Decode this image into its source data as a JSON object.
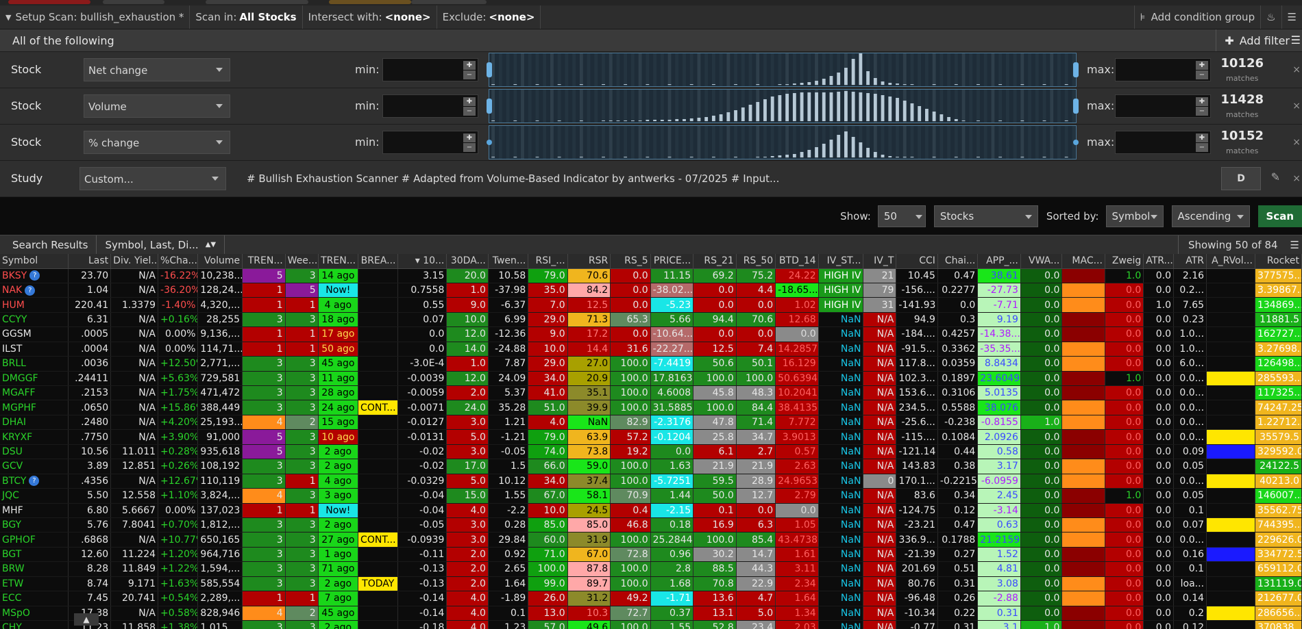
{
  "setup": {
    "title": "Setup Scan: bullish_exhaustion *",
    "scan_in_label": "Scan in:",
    "scan_in_value": "All Stocks",
    "intersect_label": "Intersect with:",
    "intersect_value": "<none>",
    "exclude_label": "Exclude:",
    "exclude_value": "<none>",
    "add_group": "Add condition group"
  },
  "all_following": "All of the following",
  "add_filter": "Add filter",
  "filters": [
    {
      "type": "Stock",
      "field": "Net change",
      "min_label": "min:",
      "max_label": "max:",
      "matches": "10126",
      "matches_label": "matches",
      "hist": [
        0,
        0,
        0,
        0,
        0,
        0,
        0,
        0,
        0,
        0,
        0,
        0,
        0,
        0,
        0,
        0,
        0,
        0,
        0,
        0,
        0,
        0,
        0,
        0,
        0,
        0,
        0,
        0,
        0,
        0,
        0,
        0,
        0,
        0,
        0,
        0,
        0,
        0,
        0,
        1,
        1,
        2,
        3,
        4,
        6,
        9,
        13,
        18,
        25,
        38,
        48,
        20,
        10,
        5,
        3,
        2,
        1,
        1,
        0,
        0,
        0,
        0,
        0,
        0,
        0,
        0,
        0,
        0,
        0,
        0,
        0,
        0,
        0,
        0,
        0,
        0,
        0,
        0,
        0,
        0
      ],
      "first": 4,
      "last": 0
    },
    {
      "type": "Stock",
      "field": "Volume",
      "min_label": "min:",
      "max_label": "max:",
      "matches": "11428",
      "matches_label": "matches",
      "hist": [
        0,
        0,
        0,
        0,
        0,
        0,
        0,
        0,
        0,
        0,
        0,
        0,
        0,
        0,
        0,
        1,
        1,
        1,
        1,
        1,
        1,
        2,
        2,
        2,
        2,
        3,
        3,
        4,
        5,
        6,
        8,
        10,
        13,
        16,
        20,
        24,
        28,
        32,
        36,
        38,
        40,
        41,
        42,
        42,
        42,
        42,
        42,
        43,
        44,
        43,
        42,
        41,
        40,
        38,
        36,
        34,
        30,
        26,
        22,
        18,
        14,
        10,
        6,
        3,
        1,
        0,
        0,
        0,
        0,
        0,
        0,
        0,
        0,
        0,
        0,
        0,
        0,
        0,
        0,
        0
      ],
      "first": 4,
      "last": 30
    },
    {
      "type": "Stock",
      "field": "% change",
      "min_label": "min:",
      "max_label": "max:",
      "matches": "10152",
      "matches_label": "matches",
      "hist": [
        0,
        0,
        0,
        0,
        0,
        0,
        0,
        0,
        0,
        0,
        0,
        0,
        0,
        0,
        0,
        0,
        0,
        0,
        0,
        0,
        0,
        0,
        0,
        0,
        0,
        0,
        0,
        0,
        0,
        0,
        0,
        0,
        0,
        0,
        0,
        0,
        1,
        1,
        2,
        3,
        4,
        5,
        8,
        11,
        15,
        20,
        26,
        33,
        38,
        30,
        22,
        14,
        8,
        4,
        2,
        1,
        1,
        0,
        0,
        0,
        0,
        0,
        0,
        0,
        0,
        0,
        0,
        0,
        0,
        0,
        0,
        0,
        0,
        0,
        0,
        0,
        0,
        0,
        0,
        0
      ],
      "first": 4,
      "last": 0
    }
  ],
  "study": {
    "label": "Study",
    "field": "Custom...",
    "script": "# Bullish Exhaustion Scanner # Adapted from Volume-Based Indicator by antwerks - 07/2025  # Input...",
    "agg": "D"
  },
  "show": {
    "label": "Show:",
    "count": "50",
    "type": "Stocks",
    "sorted_label": "Sorted by:",
    "sort_field": "Symbol",
    "order": "Ascending",
    "scan_button": "Scan"
  },
  "results": {
    "tab1": "Search Results",
    "tab2": "Symbol, Last, Di...",
    "showing": "Showing 50 of 84"
  },
  "columns": [
    "Symbol",
    "Last",
    "Div. Yiel...",
    "%Cha...",
    "Volume",
    "TREN...",
    "Wee...",
    "TREN...",
    "BREA...",
    "▾ 10...",
    "30DA...",
    "Twen...",
    "RSI_...",
    "RSR",
    "RS_5",
    "PRICE...",
    "RS_21",
    "RS_50",
    "BTD_14",
    "IV_ST...",
    "IV_T",
    "CCI",
    "Chai...",
    "APP_...",
    "VWA...",
    "MAC...",
    "Zweig",
    "ATR...",
    "ATR",
    "A_RVol...",
    "Rocket"
  ],
  "rows": [
    [
      "BKSY",
      "23.70",
      "N/A",
      "-16.22%",
      "10,238...",
      "5",
      "3",
      "14 ago",
      "",
      "3.15",
      "20.0",
      "10.58",
      "79.0",
      "70.6",
      "0.0",
      "11.15",
      "69.2",
      "75.2",
      "24.22",
      "HIGH IV",
      "21",
      "10.45",
      "0.47",
      "38.61",
      "0.0",
      "",
      "1.0",
      "0.0",
      "2.16",
      "",
      "377575..."
    ],
    [
      "NAK",
      "1.04",
      "N/A",
      "-36.20%",
      "128,24...",
      "1",
      "5",
      "Now!",
      "",
      "0.7558",
      "1.0",
      "-37.98",
      "35.0",
      "84.2",
      "0.0",
      "-38.02...",
      "0.0",
      "4.4",
      "-18.65...",
      "HIGH IV",
      "79",
      "-156....",
      "0.2277",
      "-27.73",
      "0.0",
      "",
      "0.0",
      "0.0",
      "0.2...",
      "",
      "3.39867..."
    ],
    [
      "HUM",
      "220.41",
      "1.3379",
      "-1.40%",
      "4,320,...",
      "1",
      "1",
      "4 ago",
      "",
      "0.55",
      "9.0",
      "-6.37",
      "7.0",
      "12.5",
      "0.0",
      "-5.23",
      "0.0",
      "0.0",
      "1.02",
      "HIGH IV",
      "31",
      "-141.93",
      "0.0",
      "-7.71",
      "0.0",
      "",
      "0.0",
      "1.0",
      "7.65",
      "",
      "134869..."
    ],
    [
      "CCYY",
      "6.31",
      "N/A",
      "+0.16%",
      "28,255",
      "3",
      "3",
      "18 ago",
      "",
      "0.07",
      "10.0",
      "6.99",
      "29.0",
      "71.3",
      "65.3",
      "5.66",
      "94.4",
      "70.6",
      "12.68",
      "NaN",
      "N/A",
      "94.9",
      "0.3",
      "9.19",
      "0.0",
      "",
      "0.0",
      "0.0",
      "0.23",
      "",
      "11881.5"
    ],
    [
      "GGSM",
      ".0005",
      "N/A",
      "0.00%",
      "9,136,...",
      "1",
      "1",
      "17 ago",
      "",
      "0.0",
      "12.0",
      "-12.36",
      "9.0",
      "17.2",
      "0.0",
      "-10.64...",
      "0.0",
      "0.0",
      "0.0",
      "NaN",
      "N/A",
      "-184....",
      "0.4257",
      "-14.38...",
      "0.0",
      "",
      "0.0",
      "0.0",
      "1.0...",
      "",
      "162727..."
    ],
    [
      "ILST",
      ".0004",
      "N/A",
      "0.00%",
      "114,71...",
      "1",
      "1",
      "50 ago",
      "",
      "0.0",
      "14.0",
      "-24.88",
      "10.0",
      "14.4",
      "31.6",
      "-22.27...",
      "12.5",
      "7.4",
      "14.2857",
      "NaN",
      "N/A",
      "-91.5...",
      "0.3362",
      "-35.35...",
      "0.0",
      "",
      "0.0",
      "0.0",
      "1.0...",
      "",
      "3.27698..."
    ],
    [
      "BRLL",
      ".0036",
      "N/A",
      "+12.50%",
      "2,771,...",
      "3",
      "3",
      "45 ago",
      "",
      "-3.0E-4",
      "1.0",
      "7.87",
      "29.0",
      "27.0",
      "100.0",
      "-7.4419",
      "50.6",
      "50.1",
      "16.129",
      "NaN",
      "N/A",
      "117.8...",
      "0.0359",
      "8.8434",
      "0.0",
      "",
      "0.0",
      "0.0",
      "6.0...",
      "",
      "126498..."
    ],
    [
      "DMGGF",
      ".24411",
      "N/A",
      "+5.63%",
      "729,581",
      "3",
      "3",
      "11 ago",
      "",
      "-0.0039",
      "12.0",
      "24.09",
      "34.0",
      "20.9",
      "100.0",
      "17.8163",
      "100.0",
      "100.0",
      "50.6394",
      "NaN",
      "N/A",
      "102.3...",
      "0.1897",
      "23.6049",
      "0.0",
      "",
      "1.0",
      "0.0",
      "0.0...",
      "",
      "285593..."
    ],
    [
      "MGAFF",
      ".2153",
      "N/A",
      "+1.75%",
      "471,472",
      "3",
      "3",
      "28 ago",
      "",
      "-0.0059",
      "2.0",
      "5.37",
      "41.0",
      "35.1",
      "100.0",
      "4.6008",
      "45.8",
      "48.3",
      "10.2041",
      "NaN",
      "N/A",
      "153.6...",
      "0.3106",
      "5.0135",
      "0.0",
      "",
      "0.0",
      "0.0",
      "0.0...",
      "",
      "117325..."
    ],
    [
      "MGPHF",
      ".0650",
      "N/A",
      "+15.86%",
      "388,449",
      "3",
      "3",
      "24 ago",
      "CONT...",
      "-0.0071",
      "24.0",
      "35.28",
      "51.0",
      "39.9",
      "100.0",
      "31.5885",
      "100.0",
      "84.4",
      "38.4135",
      "NaN",
      "N/A",
      "234.5...",
      "0.5588",
      "38.076",
      "0.0",
      "",
      "0.0",
      "0.0",
      "0.0...",
      "",
      "74247.25"
    ],
    [
      "DHAI",
      ".2480",
      "N/A",
      "+4.20%",
      "25,193...",
      "4",
      "2",
      "15 ago",
      "",
      "-0.0127",
      "3.0",
      "1.21",
      "4.0",
      "NaN",
      "82.9",
      "-2.3176",
      "47.8",
      "71.4",
      "7.772",
      "NaN",
      "N/A",
      "-25.6...",
      "-0.238",
      "-0.8155",
      "1.0",
      "",
      "0.0",
      "0.0",
      "0.0...",
      "",
      "1.22712..."
    ],
    [
      "KRYXF",
      ".7750",
      "N/A",
      "+3.90%",
      "91,000",
      "5",
      "3",
      "10 ago",
      "",
      "-0.0131",
      "5.0",
      "-1.21",
      "79.0",
      "63.9",
      "57.2",
      "-0.1204",
      "25.8",
      "34.7",
      "3.9013",
      "NaN",
      "N/A",
      "-115....",
      "0.1084",
      "2.0926",
      "0.0",
      "",
      "0.0",
      "0.0",
      "0.0...",
      "",
      "35579.5"
    ],
    [
      "DSU",
      "10.56",
      "11.011",
      "+0.28%",
      "935,618",
      "5",
      "3",
      "2 ago",
      "",
      "-0.02",
      "3.0",
      "-0.05",
      "74.0",
      "73.8",
      "19.2",
      "0.0",
      "6.1",
      "2.7",
      "0.57",
      "NaN",
      "N/A",
      "-121.14",
      "0.44",
      "0.58",
      "0.0",
      "",
      "0.0",
      "0.0",
      "0.09",
      "",
      "329592.0"
    ],
    [
      "GCV",
      "3.89",
      "12.851",
      "+0.26%",
      "108,192",
      "3",
      "3",
      "2 ago",
      "",
      "-0.02",
      "17.0",
      "1.5",
      "66.0",
      "59.0",
      "100.0",
      "1.63",
      "21.9",
      "21.9",
      "2.63",
      "NaN",
      "N/A",
      "143.83",
      "0.38",
      "3.17",
      "0.0",
      "",
      "0.0",
      "0.0",
      "0.05",
      "",
      "24122.5"
    ],
    [
      "BTCY",
      ".4356",
      "N/A",
      "+12.67%",
      "110,119",
      "3",
      "1",
      "4 ago",
      "",
      "-0.0329",
      "5.0",
      "10.12",
      "34.0",
      "37.4",
      "100.0",
      "-5.7251",
      "59.5",
      "28.9",
      "24.9653",
      "NaN",
      "0",
      "170.1...",
      "-0.2215",
      "-6.0959",
      "0.0",
      "",
      "0.0",
      "0.0",
      "0.0...",
      "",
      "40213.0"
    ],
    [
      "JQC",
      "5.50",
      "12.558",
      "+1.10%",
      "3,824,...",
      "4",
      "3",
      "3 ago",
      "",
      "-0.04",
      "15.0",
      "1.55",
      "67.0",
      "58.1",
      "70.9",
      "1.44",
      "50.0",
      "12.7",
      "2.79",
      "NaN",
      "N/A",
      "83.6",
      "0.34",
      "2.45",
      "0.0",
      "",
      "1.0",
      "0.0",
      "0.05",
      "",
      "146007..."
    ],
    [
      "MHF",
      "6.80",
      "5.6667",
      "0.00%",
      "137,023",
      "1",
      "1",
      "Now!",
      "",
      "-0.04",
      "4.0",
      "-2.2",
      "10.0",
      "24.5",
      "0.4",
      "-2.15",
      "0.1",
      "0.0",
      "0.0",
      "NaN",
      "N/A",
      "-124.75",
      "0.12",
      "-3.14",
      "0.0",
      "",
      "0.0",
      "0.0",
      "0.1",
      "",
      "35562.75"
    ],
    [
      "BGY",
      "5.76",
      "7.8041",
      "+0.70%",
      "1,812,...",
      "3",
      "3",
      "2 ago",
      "",
      "-0.05",
      "3.0",
      "0.28",
      "85.0",
      "85.0",
      "46.8",
      "0.18",
      "16.9",
      "6.3",
      "1.05",
      "NaN",
      "N/A",
      "-23.21",
      "0.47",
      "0.63",
      "0.0",
      "",
      "0.0",
      "0.0",
      "0.07",
      "",
      "744395..."
    ],
    [
      "GPHOF",
      ".6868",
      "N/A",
      "+10.77%",
      "650,165",
      "3",
      "3",
      "27 ago",
      "CONT...",
      "-0.0939",
      "3.0",
      "29.84",
      "60.0",
      "31.9",
      "100.0",
      "25.2844",
      "100.0",
      "85.4",
      "43.4738",
      "NaN",
      "N/A",
      "336.9...",
      "0.1788",
      "21.2159",
      "0.0",
      "",
      "0.0",
      "0.0",
      "0.0...",
      "",
      "229626.0"
    ],
    [
      "BGT",
      "12.60",
      "11.224",
      "+1.20%",
      "964,716",
      "3",
      "3",
      "1 ago",
      "",
      "-0.11",
      "2.0",
      "0.92",
      "71.0",
      "67.0",
      "72.8",
      "0.96",
      "30.2",
      "14.7",
      "1.61",
      "NaN",
      "N/A",
      "-21.39",
      "0.27",
      "1.52",
      "0.0",
      "",
      "0.0",
      "0.0",
      "0.16",
      "",
      "334772.5"
    ],
    [
      "BRW",
      "8.28",
      "11.849",
      "+1.22%",
      "1,594,...",
      "3",
      "3",
      "71 ago",
      "",
      "-0.13",
      "2.0",
      "2.65",
      "100.0",
      "87.8",
      "100.0",
      "2.8",
      "88.5",
      "44.3",
      "3.11",
      "NaN",
      "N/A",
      "201.69",
      "0.51",
      "4.81",
      "0.0",
      "",
      "0.0",
      "0.0",
      "0.1",
      "",
      "659112.0"
    ],
    [
      "ETW",
      "8.74",
      "9.171",
      "+1.63%",
      "585,554",
      "3",
      "3",
      "2 ago",
      "TODAY",
      "-0.13",
      "2.0",
      "1.64",
      "99.0",
      "89.7",
      "100.0",
      "1.68",
      "70.8",
      "22.9",
      "2.34",
      "NaN",
      "N/A",
      "80.76",
      "0.31",
      "3.08",
      "0.0",
      "",
      "0.0",
      "0.0",
      "loa...",
      "",
      "131119.0"
    ],
    [
      "ECC",
      "7.45",
      "20.741",
      "+0.54%",
      "2,289,...",
      "1",
      "1",
      "7 ago",
      "",
      "-0.14",
      "4.0",
      "-1.89",
      "26.0",
      "31.2",
      "49.2",
      "-1.71",
      "13.6",
      "4.7",
      "1.64",
      "NaN",
      "N/A",
      "-96.48",
      "0.26",
      "-2.88",
      "0.0",
      "",
      "0.0",
      "0.0",
      "0.14",
      "",
      "212677.0"
    ],
    [
      "MSpO",
      "17.38",
      "N/A",
      "+0.58%",
      "828,946",
      "4",
      "2",
      "45 ago",
      "",
      "-0.14",
      "4.0",
      "0.1",
      "13.0",
      "10.3",
      "72.7",
      "0.37",
      "13.1",
      "5.0",
      "1.34",
      "NaN",
      "N/A",
      "-10.34",
      "0.22",
      "0.31",
      "0.0",
      "",
      "0.0",
      "0.0",
      "0.2",
      "",
      "286656..."
    ],
    [
      "CHY",
      "11.23",
      "11.858",
      "+1.38%",
      "1,015,...",
      "3",
      "3",
      "2 ago",
      "",
      "-0.18",
      "4.0",
      "1.23",
      "57.0",
      "49.6",
      "100.0",
      "1.55",
      "52.8",
      "23.4",
      "2.03",
      "NaN",
      "N/A",
      "-0.77",
      "0.31",
      "3.1",
      "1.0",
      "",
      "0.0",
      "0.0",
      "0.12",
      "",
      "370838..."
    ]
  ],
  "colors": {
    "green": "#1e8a1e",
    "dark_green": "#0e5e0e",
    "bright_green": "#19e619",
    "red": "#b30000",
    "purple": "#8a1a9a",
    "orange": "#ff8c1a",
    "yellow": "#ffe600",
    "gold": "#f0b51e",
    "cyan": "#19e6e6",
    "grey": "#8a8a8a",
    "accent_blue": "#4a7898",
    "scan_green": "#1f6b35"
  }
}
